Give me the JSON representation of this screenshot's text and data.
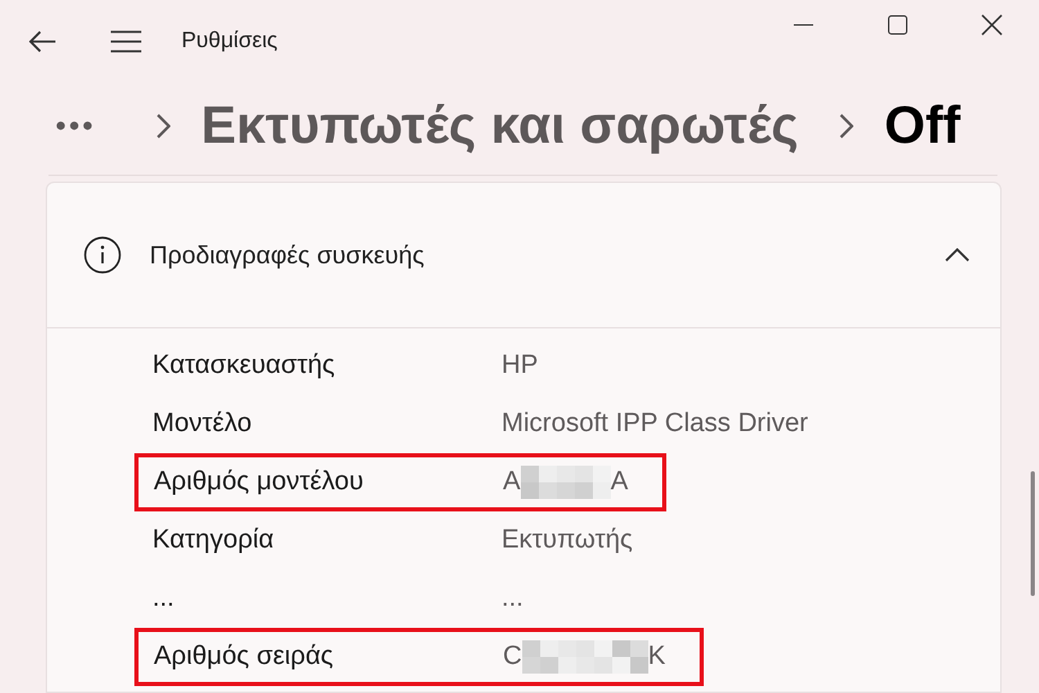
{
  "window": {
    "title": "Ρυθμίσεις"
  },
  "breadcrumb": [
    {
      "kind": "more",
      "text": "•••"
    },
    {
      "kind": "link",
      "text": "Εκτυπωτές και σαρωτές"
    },
    {
      "kind": "current",
      "text": "Off"
    }
  ],
  "section": {
    "title": "Προδιαγραφές συσκευής",
    "expanded": true,
    "rows": [
      {
        "label": "Κατασκευαστής",
        "value_start": "HP",
        "redacted": false,
        "highlighted": false
      },
      {
        "label": "Μοντέλο",
        "value_start": "Microsoft IPP Class Driver",
        "redacted": false,
        "highlighted": false
      },
      {
        "label": "Αριθμός μοντέλου",
        "value_start": "A",
        "value_end": "A",
        "redacted": true,
        "highlighted": true
      },
      {
        "label": "Κατηγορία",
        "value_start": "Εκτυπωτής",
        "redacted": false,
        "highlighted": false
      },
      {
        "label": "...",
        "value_start": "...",
        "redacted": false,
        "highlighted": false
      },
      {
        "label": "Αριθμός σειράς",
        "value_start": "C",
        "value_end": "K",
        "redacted": true,
        "highlighted": true
      }
    ]
  }
}
